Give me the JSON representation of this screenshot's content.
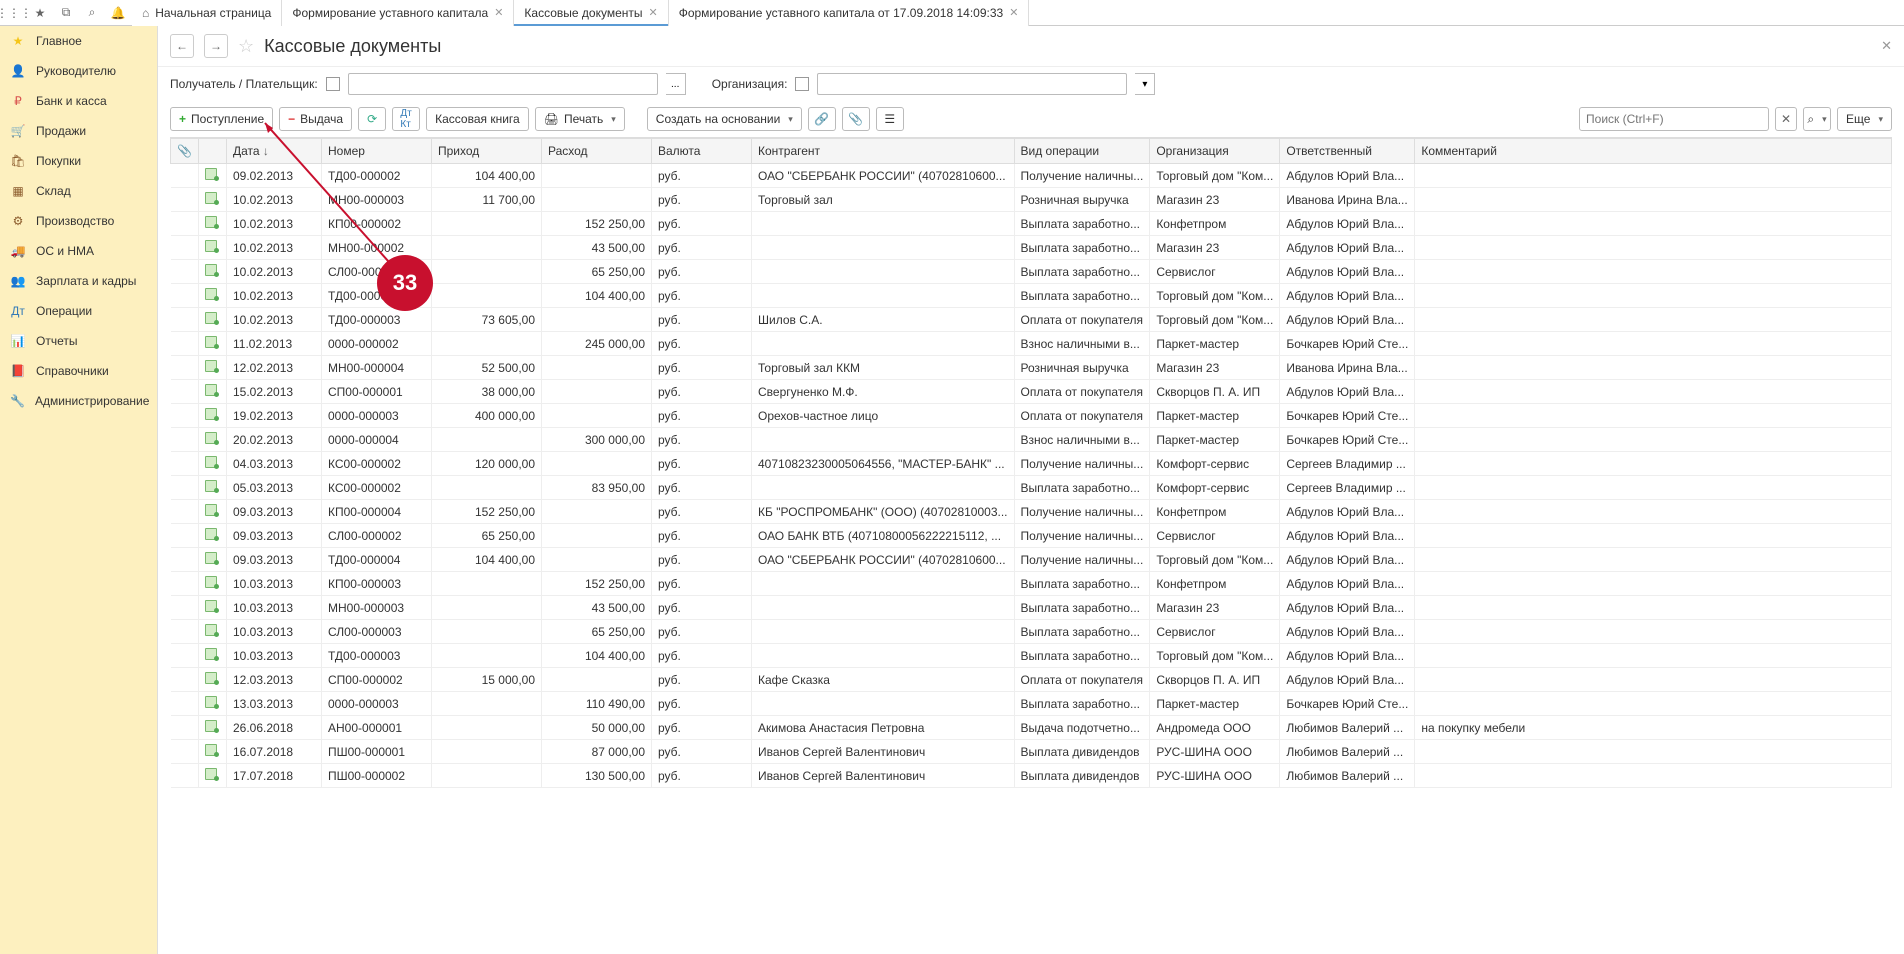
{
  "tabs": [
    {
      "label": "Начальная страница",
      "closable": false,
      "home": true
    },
    {
      "label": "Формирование уставного капитала",
      "closable": true
    },
    {
      "label": "Кассовые документы",
      "closable": true,
      "active": true
    },
    {
      "label": "Формирование уставного капитала от 17.09.2018 14:09:33",
      "closable": true
    }
  ],
  "sidebar": [
    {
      "label": "Главное",
      "icon": "star",
      "color": "#f5c518"
    },
    {
      "label": "Руководителю",
      "icon": "person",
      "color": "#d9534f"
    },
    {
      "label": "Банк и касса",
      "icon": "coin",
      "color": "#d9534f"
    },
    {
      "label": "Продажи",
      "icon": "cart",
      "color": "#8a5a2b"
    },
    {
      "label": "Покупки",
      "icon": "cart2",
      "color": "#8a5a2b"
    },
    {
      "label": "Склад",
      "icon": "boxes",
      "color": "#8a5a2b"
    },
    {
      "label": "Производство",
      "icon": "gear",
      "color": "#8a5a2b"
    },
    {
      "label": "ОС и НМА",
      "icon": "truck",
      "color": "#6a6a6a"
    },
    {
      "label": "Зарплата и кадры",
      "icon": "users",
      "color": "#d9534f"
    },
    {
      "label": "Операции",
      "icon": "dk",
      "color": "#337ab7"
    },
    {
      "label": "Отчеты",
      "icon": "chart",
      "color": "#337ab7"
    },
    {
      "label": "Справочники",
      "icon": "book",
      "color": "#8a5a2b"
    },
    {
      "label": "Администрирование",
      "icon": "wrench",
      "color": "#6a6a6a"
    }
  ],
  "page": {
    "title": "Кассовые документы"
  },
  "filters": {
    "payer_label": "Получатель / Плательщик:",
    "org_label": "Организация:"
  },
  "toolbar": {
    "income": "Поступление",
    "outcome": "Выдача",
    "cashbook": "Кассовая книга",
    "print": "Печать",
    "create_based": "Создать на основании",
    "search_placeholder": "Поиск (Ctrl+F)",
    "more": "Еще"
  },
  "columns": {
    "date": "Дата",
    "number": "Номер",
    "income": "Приход",
    "expense": "Расход",
    "currency": "Валюта",
    "counterparty": "Контрагент",
    "op_type": "Вид операции",
    "org": "Организация",
    "responsible": "Ответственный",
    "comment": "Комментарий"
  },
  "rows": [
    {
      "date": "09.02.2013",
      "num": "ТД00-000002",
      "in": "104 400,00",
      "out": "",
      "cur": "руб.",
      "agent": "ОАО \"СБЕРБАНК РОССИИ\" (40702810600...",
      "op": "Получение наличны...",
      "org": "Торговый дом \"Ком...",
      "resp": "Абдулов Юрий Вла...",
      "comment": ""
    },
    {
      "date": "10.02.2013",
      "num": "МН00-000003",
      "in": "11 700,00",
      "out": "",
      "cur": "руб.",
      "agent": "Торговый зал",
      "op": "Розничная выручка",
      "org": "Магазин 23",
      "resp": "Иванова Ирина Вла...",
      "comment": ""
    },
    {
      "date": "10.02.2013",
      "num": "КП00-000002",
      "in": "",
      "out": "152 250,00",
      "cur": "руб.",
      "agent": "",
      "op": "Выплата заработно...",
      "org": "Конфетпром",
      "resp": "Абдулов Юрий Вла...",
      "comment": ""
    },
    {
      "date": "10.02.2013",
      "num": "МН00-000002",
      "in": "",
      "out": "43 500,00",
      "cur": "руб.",
      "agent": "",
      "op": "Выплата заработно...",
      "org": "Магазин 23",
      "resp": "Абдулов Юрий Вла...",
      "comment": ""
    },
    {
      "date": "10.02.2013",
      "num": "СЛ00-000002",
      "in": "",
      "out": "65 250,00",
      "cur": "руб.",
      "agent": "",
      "op": "Выплата заработно...",
      "org": "Сервислог",
      "resp": "Абдулов Юрий Вла...",
      "comment": ""
    },
    {
      "date": "10.02.2013",
      "num": "ТД00-000002",
      "in": "",
      "out": "104 400,00",
      "cur": "руб.",
      "agent": "",
      "op": "Выплата заработно...",
      "org": "Торговый дом \"Ком...",
      "resp": "Абдулов Юрий Вла...",
      "comment": ""
    },
    {
      "date": "10.02.2013",
      "num": "ТД00-000003",
      "in": "73 605,00",
      "out": "",
      "cur": "руб.",
      "agent": "Шилов С.А.",
      "op": "Оплата от покупателя",
      "org": "Торговый дом \"Ком...",
      "resp": "Абдулов Юрий Вла...",
      "comment": ""
    },
    {
      "date": "11.02.2013",
      "num": "0000-000002",
      "in": "",
      "out": "245 000,00",
      "cur": "руб.",
      "agent": "",
      "op": "Взнос наличными в...",
      "org": "Паркет-мастер",
      "resp": "Бочкарев Юрий Сте...",
      "comment": ""
    },
    {
      "date": "12.02.2013",
      "num": "МН00-000004",
      "in": "52 500,00",
      "out": "",
      "cur": "руб.",
      "agent": "Торговый зал ККМ",
      "op": "Розничная выручка",
      "org": "Магазин 23",
      "resp": "Иванова Ирина Вла...",
      "comment": ""
    },
    {
      "date": "15.02.2013",
      "num": "СП00-000001",
      "in": "38 000,00",
      "out": "",
      "cur": "руб.",
      "agent": "Свергуненко М.Ф.",
      "op": "Оплата от покупателя",
      "org": "Скворцов П. А. ИП",
      "resp": "Абдулов Юрий Вла...",
      "comment": ""
    },
    {
      "date": "19.02.2013",
      "num": "0000-000003",
      "in": "400 000,00",
      "out": "",
      "cur": "руб.",
      "agent": "Орехов-частное лицо",
      "op": "Оплата от покупателя",
      "org": "Паркет-мастер",
      "resp": "Бочкарев Юрий Сте...",
      "comment": ""
    },
    {
      "date": "20.02.2013",
      "num": "0000-000004",
      "in": "",
      "out": "300 000,00",
      "cur": "руб.",
      "agent": "",
      "op": "Взнос наличными в...",
      "org": "Паркет-мастер",
      "resp": "Бочкарев Юрий Сте...",
      "comment": ""
    },
    {
      "date": "04.03.2013",
      "num": "КС00-000002",
      "in": "120 000,00",
      "out": "",
      "cur": "руб.",
      "agent": "40710823230005064556, \"МАСТЕР-БАНК\" ...",
      "op": "Получение наличны...",
      "org": "Комфорт-сервис",
      "resp": "Сергеев Владимир ...",
      "comment": ""
    },
    {
      "date": "05.03.2013",
      "num": "КС00-000002",
      "in": "",
      "out": "83 950,00",
      "cur": "руб.",
      "agent": "",
      "op": "Выплата заработно...",
      "org": "Комфорт-сервис",
      "resp": "Сергеев Владимир ...",
      "comment": ""
    },
    {
      "date": "09.03.2013",
      "num": "КП00-000004",
      "in": "152 250,00",
      "out": "",
      "cur": "руб.",
      "agent": "КБ \"РОСПРОМБАНК\" (ООО) (40702810003...",
      "op": "Получение наличны...",
      "org": "Конфетпром",
      "resp": "Абдулов Юрий Вла...",
      "comment": ""
    },
    {
      "date": "09.03.2013",
      "num": "СЛ00-000002",
      "in": "65 250,00",
      "out": "",
      "cur": "руб.",
      "agent": "ОАО БАНК ВТБ (40710800056222215112, ...",
      "op": "Получение наличны...",
      "org": "Сервислог",
      "resp": "Абдулов Юрий Вла...",
      "comment": ""
    },
    {
      "date": "09.03.2013",
      "num": "ТД00-000004",
      "in": "104 400,00",
      "out": "",
      "cur": "руб.",
      "agent": "ОАО \"СБЕРБАНК РОССИИ\" (40702810600...",
      "op": "Получение наличны...",
      "org": "Торговый дом \"Ком...",
      "resp": "Абдулов Юрий Вла...",
      "comment": ""
    },
    {
      "date": "10.03.2013",
      "num": "КП00-000003",
      "in": "",
      "out": "152 250,00",
      "cur": "руб.",
      "agent": "",
      "op": "Выплата заработно...",
      "org": "Конфетпром",
      "resp": "Абдулов Юрий Вла...",
      "comment": ""
    },
    {
      "date": "10.03.2013",
      "num": "МН00-000003",
      "in": "",
      "out": "43 500,00",
      "cur": "руб.",
      "agent": "",
      "op": "Выплата заработно...",
      "org": "Магазин 23",
      "resp": "Абдулов Юрий Вла...",
      "comment": ""
    },
    {
      "date": "10.03.2013",
      "num": "СЛ00-000003",
      "in": "",
      "out": "65 250,00",
      "cur": "руб.",
      "agent": "",
      "op": "Выплата заработно...",
      "org": "Сервислог",
      "resp": "Абдулов Юрий Вла...",
      "comment": ""
    },
    {
      "date": "10.03.2013",
      "num": "ТД00-000003",
      "in": "",
      "out": "104 400,00",
      "cur": "руб.",
      "agent": "",
      "op": "Выплата заработно...",
      "org": "Торговый дом \"Ком...",
      "resp": "Абдулов Юрий Вла...",
      "comment": ""
    },
    {
      "date": "12.03.2013",
      "num": "СП00-000002",
      "in": "15 000,00",
      "out": "",
      "cur": "руб.",
      "agent": "Кафе Сказка",
      "op": "Оплата от покупателя",
      "org": "Скворцов П. А. ИП",
      "resp": "Абдулов Юрий Вла...",
      "comment": ""
    },
    {
      "date": "13.03.2013",
      "num": "0000-000003",
      "in": "",
      "out": "110 490,00",
      "cur": "руб.",
      "agent": "",
      "op": "Выплата заработно...",
      "org": "Паркет-мастер",
      "resp": "Бочкарев Юрий Сте...",
      "comment": ""
    },
    {
      "date": "26.06.2018",
      "num": "АН00-000001",
      "in": "",
      "out": "50 000,00",
      "cur": "руб.",
      "agent": "Акимова Анастасия Петровна",
      "op": "Выдача подотчетно...",
      "org": "Андромеда ООО",
      "resp": "Любимов Валерий ...",
      "comment": "на покупку мебели"
    },
    {
      "date": "16.07.2018",
      "num": "ПШ00-000001",
      "in": "",
      "out": "87 000,00",
      "cur": "руб.",
      "agent": "Иванов Сергей Валентинович",
      "op": "Выплата дивидендов",
      "org": "РУС-ШИНА ООО",
      "resp": "Любимов Валерий ...",
      "comment": ""
    },
    {
      "date": "17.07.2018",
      "num": "ПШ00-000002",
      "in": "",
      "out": "130 500,00",
      "cur": "руб.",
      "agent": "Иванов Сергей Валентинович",
      "op": "Выплата дивидендов",
      "org": "РУС-ШИНА ООО",
      "resp": "Любимов Валерий ...",
      "comment": ""
    }
  ],
  "annotation": {
    "number": "33"
  }
}
